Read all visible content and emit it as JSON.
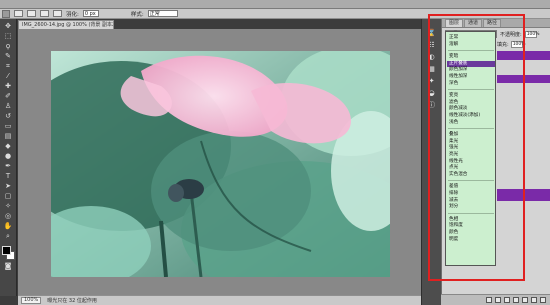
{
  "options_bar": {
    "feather_label": "羽化:",
    "feather_value": "0 px",
    "style_label": "样式:",
    "style_value": "正常"
  },
  "document": {
    "tab_title": "IMG_2600-14.jpg @ 100% (背景 副本2, RGB/8) *"
  },
  "status_bar": {
    "zoom": "100%",
    "doc_info": "曝光只在 32 位起作用"
  },
  "layers_panel": {
    "tabs": [
      "图层",
      "通道",
      "路径"
    ],
    "blend_mode": "正常",
    "opacity_label": "不透明度:",
    "opacity_value": "100%",
    "fill_label": "填充:",
    "fill_value": "100%"
  },
  "blend_modes": [
    {
      "label": "正常",
      "selected": false
    },
    {
      "label": "溶解",
      "selected": false
    },
    {
      "sep": true
    },
    {
      "label": "变暗",
      "selected": false
    },
    {
      "label": "正片叠底",
      "selected": true
    },
    {
      "label": "颜色加深",
      "selected": false
    },
    {
      "label": "线性加深",
      "selected": false
    },
    {
      "label": "深色",
      "selected": false
    },
    {
      "sep": true
    },
    {
      "label": "变亮",
      "selected": false
    },
    {
      "label": "滤色",
      "selected": false
    },
    {
      "label": "颜色减淡",
      "selected": false
    },
    {
      "label": "线性减淡(添加)",
      "selected": false
    },
    {
      "label": "浅色",
      "selected": false
    },
    {
      "sep": true
    },
    {
      "label": "叠加",
      "selected": false
    },
    {
      "label": "柔光",
      "selected": false
    },
    {
      "label": "强光",
      "selected": false
    },
    {
      "label": "亮光",
      "selected": false
    },
    {
      "label": "线性光",
      "selected": false
    },
    {
      "label": "点光",
      "selected": false
    },
    {
      "label": "实色混合",
      "selected": false
    },
    {
      "sep": true
    },
    {
      "label": "差值",
      "selected": false
    },
    {
      "label": "排除",
      "selected": false
    },
    {
      "label": "减去",
      "selected": false
    },
    {
      "label": "划分",
      "selected": false
    },
    {
      "sep": true
    },
    {
      "label": "色相",
      "selected": false
    },
    {
      "label": "饱和度",
      "selected": false
    },
    {
      "label": "颜色",
      "selected": false
    },
    {
      "label": "明度",
      "selected": false
    }
  ],
  "colors": {
    "highlight_box": "#e02020",
    "selected_item": "#6a3a9c",
    "dropdown_bg": "#ccefcf"
  }
}
